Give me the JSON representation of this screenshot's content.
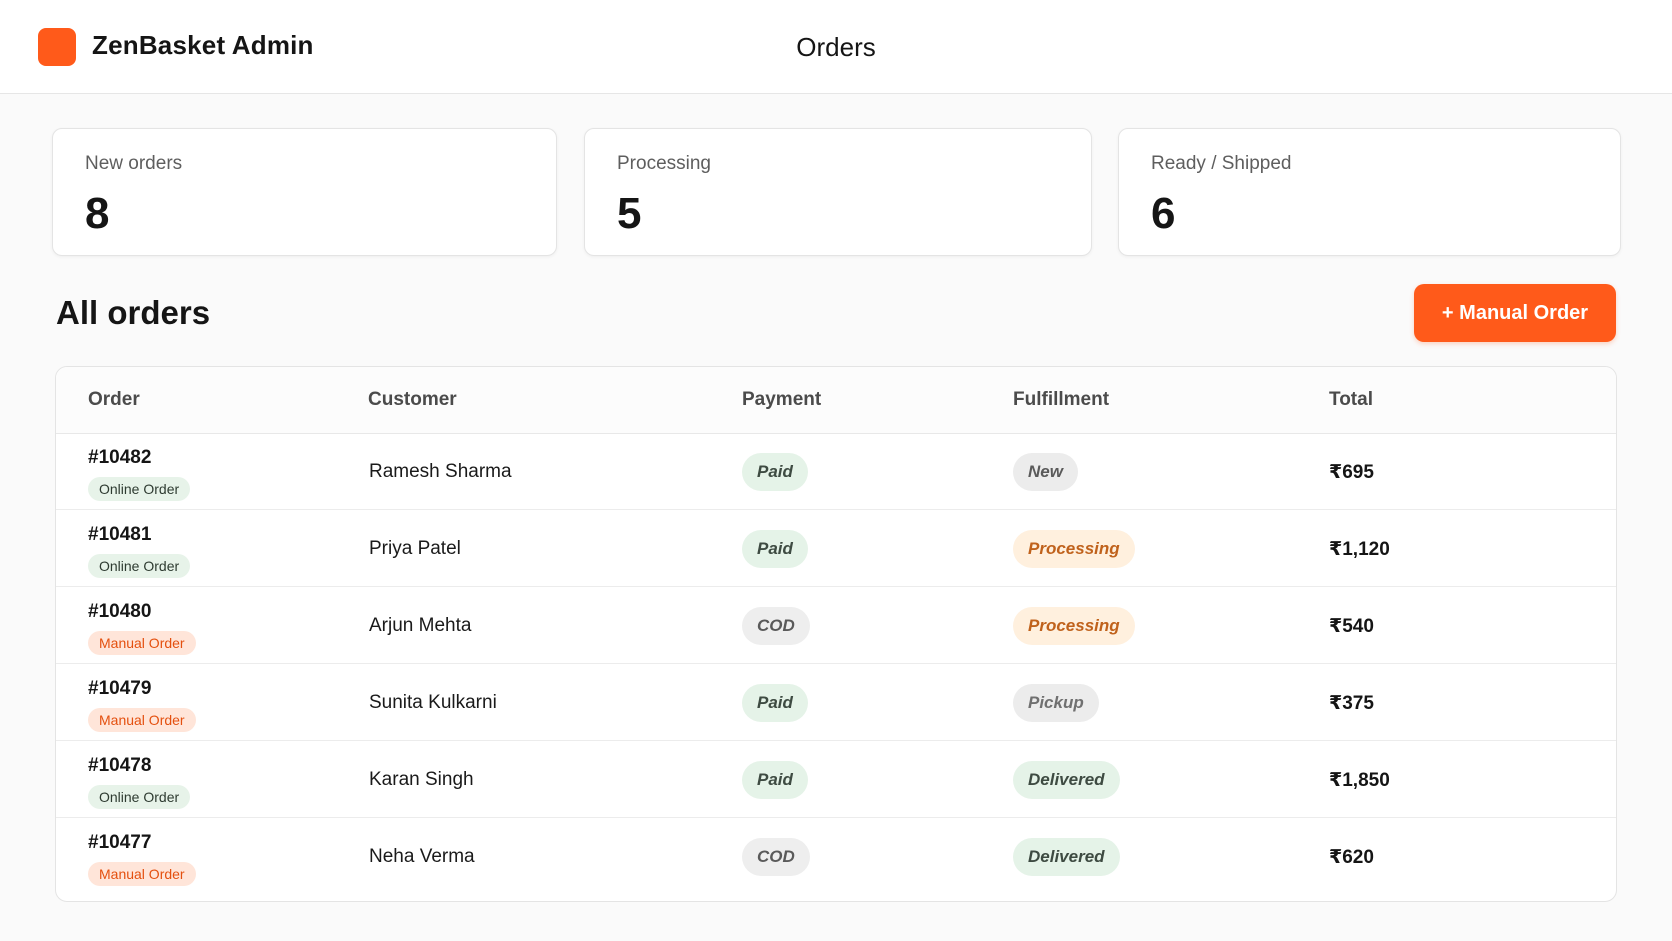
{
  "header": {
    "app_name": "ZenBasket Admin",
    "page_title": "Orders"
  },
  "stats": [
    {
      "label": "New orders",
      "value": "8"
    },
    {
      "label": "Processing",
      "value": "5"
    },
    {
      "label": "Ready / Shipped",
      "value": "6"
    }
  ],
  "section": {
    "title": "All orders",
    "manual_button_label": "+ Manual Order"
  },
  "table": {
    "columns": [
      "Order",
      "Customer",
      "Payment",
      "Fulfillment",
      "Total"
    ],
    "rows": [
      {
        "order_id": "#10482",
        "type": "Online Order",
        "customer": "Ramesh Sharma",
        "payment": "Paid",
        "fulfillment": "New",
        "total": "₹695"
      },
      {
        "order_id": "#10481",
        "type": "Online Order",
        "customer": "Priya Patel",
        "payment": "Paid",
        "fulfillment": "Processing",
        "total": "₹1,120"
      },
      {
        "order_id": "#10480",
        "type": "Manual Order",
        "customer": "Arjun Mehta",
        "payment": "COD",
        "fulfillment": "Processing",
        "total": "₹540"
      },
      {
        "order_id": "#10479",
        "type": "Manual Order",
        "customer": "Sunita Kulkarni",
        "payment": "Paid",
        "fulfillment": "Pickup",
        "total": "₹375"
      },
      {
        "order_id": "#10478",
        "type": "Online Order",
        "customer": "Karan Singh",
        "payment": "Paid",
        "fulfillment": "Delivered",
        "total": "₹1,850"
      },
      {
        "order_id": "#10477",
        "type": "Manual Order",
        "customer": "Neha Verma",
        "payment": "COD",
        "fulfillment": "Delivered",
        "total": "₹620"
      }
    ]
  },
  "colors": {
    "brand": "#ff5a1a",
    "paid_bg": "#e5f3e8",
    "processing_bg": "#fff0de",
    "manual_tag_bg": "#ffe5d9",
    "online_tag_bg": "#e7f3e9"
  }
}
